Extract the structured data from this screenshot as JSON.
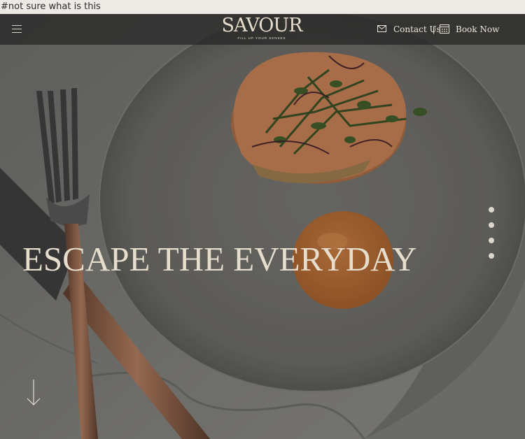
{
  "note": "#not sure what is this",
  "header": {
    "logo": "SAVOUR",
    "tagline": "FILL UP YOUR SENSES",
    "contact_label": "Contact Us",
    "separator": "|",
    "book_label": "Book Now"
  },
  "hero": {
    "headline": "ESCAPE THE EVERYDAY",
    "slides": [
      "slide-1",
      "slide-2",
      "slide-3",
      "slide-4"
    ],
    "image": "plated shrimp toast with microgreens and orange sauce, fork and knife on marble"
  },
  "icons": [
    "hamburger-menu-icon",
    "envelope-icon",
    "calendar-icon",
    "arrow-down-icon"
  ]
}
